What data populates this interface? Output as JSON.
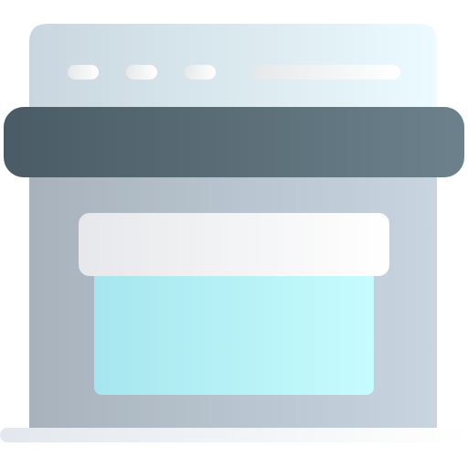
{
  "icon": {
    "name": "browser-window-icon",
    "description_label": ""
  },
  "colors": {
    "top_panel_start": "#C9D6DF",
    "top_panel_end": "#ECFBFF",
    "body_start": "#A7B2BC",
    "body_end": "#C8D5E0",
    "band_start": "#4A5B65",
    "band_end": "#6B818B",
    "pill_start": "#E6E8EB",
    "pill_end": "#FFFFFF",
    "screen_start": "#A6E6EE",
    "screen_end": "#C6FCFF",
    "screen_cap_start": "#E6E8EB",
    "screen_cap_end": "#FFFFFF",
    "base_start": "#E3E8EE",
    "base_end": "#FFFFFF"
  }
}
